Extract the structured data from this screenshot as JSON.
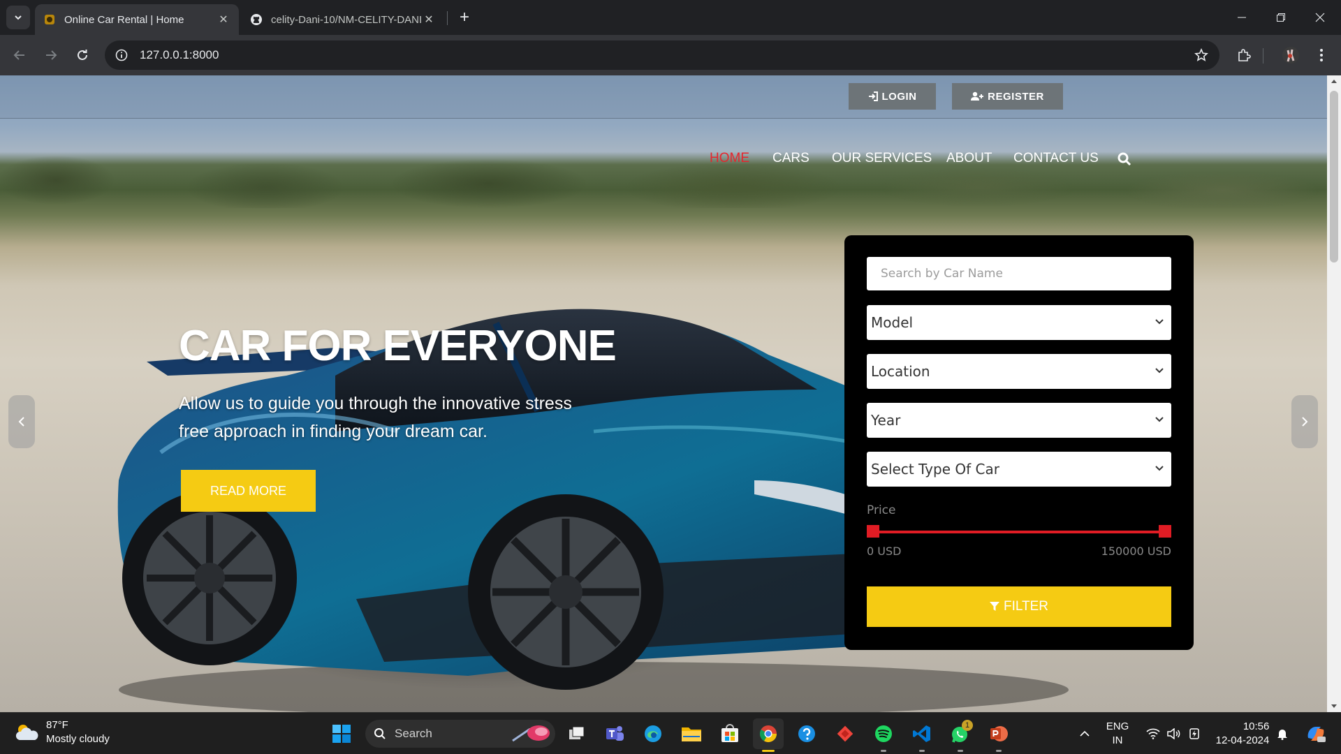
{
  "browser": {
    "tabs": [
      {
        "title": "Online Car Rental | Home",
        "active": true
      },
      {
        "title": "celity-Dani-10/NM-CELITY-DANI",
        "active": false
      }
    ],
    "url": "127.0.0.1:8000"
  },
  "site": {
    "auth": {
      "login": "LOGIN",
      "register": "REGISTER"
    },
    "nav": [
      {
        "label": "HOME",
        "active": true
      },
      {
        "label": "CARS",
        "active": false
      },
      {
        "label": "OUR SERVICES",
        "active": false
      },
      {
        "label": "ABOUT",
        "active": false
      },
      {
        "label": "CONTACT US",
        "active": false
      }
    ],
    "hero": {
      "title": "CAR FOR EVERYONE",
      "subtitle": "Allow us to guide you through the innovative stress free approach in finding your dream car.",
      "cta": "READ MORE"
    },
    "filter": {
      "search_placeholder": "Search by Car Name",
      "model": "Model",
      "location": "Location",
      "year": "Year",
      "type": "Select Type Of Car",
      "price_label": "Price",
      "price_min": "0 USD",
      "price_max": "150000 USD",
      "button": "FILTER"
    },
    "colors": {
      "accent_yellow": "#f5cb13",
      "accent_red": "#e5262e"
    }
  },
  "taskbar": {
    "weather_temp": "87°F",
    "weather_desc": "Mostly cloudy",
    "search": "Search",
    "language_1": "ENG",
    "language_2": "IN",
    "time": "10:56",
    "date": "12-04-2024",
    "whatsapp_badge": "1"
  }
}
